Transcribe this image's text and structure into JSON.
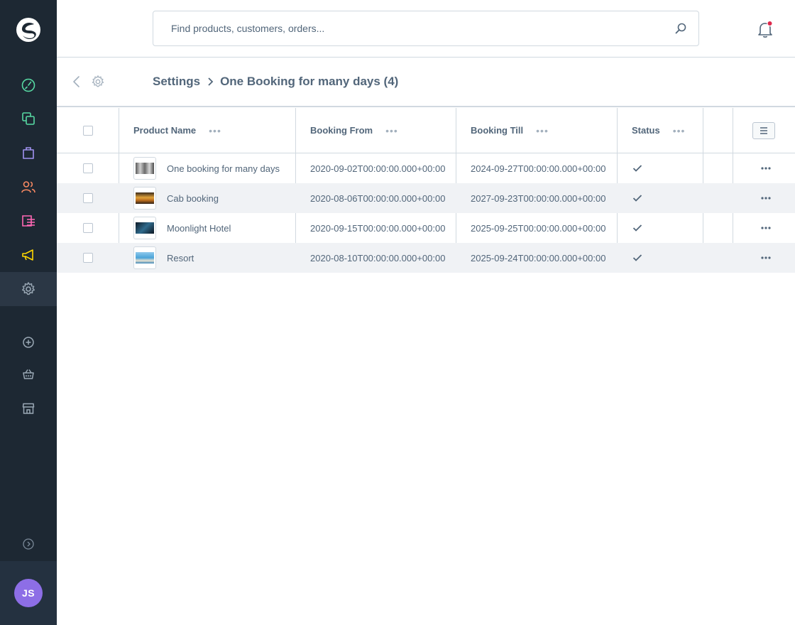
{
  "sidebar": {
    "nav": [
      {
        "name": "dashboard",
        "icon": "dashboard-icon",
        "color": "#57d9a3"
      },
      {
        "name": "catalogues",
        "icon": "catalogue-icon",
        "color": "#57d9a3"
      },
      {
        "name": "orders",
        "icon": "orders-icon",
        "color": "#a092f0"
      },
      {
        "name": "customers",
        "icon": "customers-icon",
        "color": "#f88962"
      },
      {
        "name": "content",
        "icon": "content-icon",
        "color": "#ff68b4"
      },
      {
        "name": "marketing",
        "icon": "marketing-icon",
        "color": "#ffd700"
      },
      {
        "name": "settings",
        "icon": "settings-icon",
        "color": "#9aa8b5",
        "active": true
      }
    ],
    "sub": [
      {
        "name": "add",
        "icon": "plus-circle-icon"
      },
      {
        "name": "shop",
        "icon": "basket-icon"
      },
      {
        "name": "sales-channel",
        "icon": "storefront-icon"
      }
    ],
    "user_initials": "JS",
    "avatar_color": "#8d6ee6"
  },
  "header": {
    "search_placeholder": "Find products, customers, orders...",
    "notification_dot_color": "#de294c"
  },
  "smartbar": {
    "breadcrumb_root": "Settings",
    "breadcrumb_current": "One Booking for many days (4)"
  },
  "grid": {
    "columns": [
      "Product Name",
      "Booking From",
      "Booking Till",
      "Status"
    ],
    "rows": [
      {
        "name": "One booking for many days",
        "from": "2020-09-02T00:00:00.000+00:00",
        "till": "2024-09-27T00:00:00.000+00:00",
        "status": true,
        "thumb": "#7a7a7a"
      },
      {
        "name": "Cab booking",
        "from": "2020-08-06T00:00:00.000+00:00",
        "till": "2027-09-23T00:00:00.000+00:00",
        "status": true,
        "thumb": "#c48a2e"
      },
      {
        "name": "Moonlight Hotel",
        "from": "2020-09-15T00:00:00.000+00:00",
        "till": "2025-09-25T00:00:00.000+00:00",
        "status": true,
        "thumb": "#1d3b52"
      },
      {
        "name": "Resort",
        "from": "2020-08-10T00:00:00.000+00:00",
        "till": "2025-09-24T00:00:00.000+00:00",
        "status": true,
        "thumb": "#4aa3d8"
      }
    ]
  }
}
